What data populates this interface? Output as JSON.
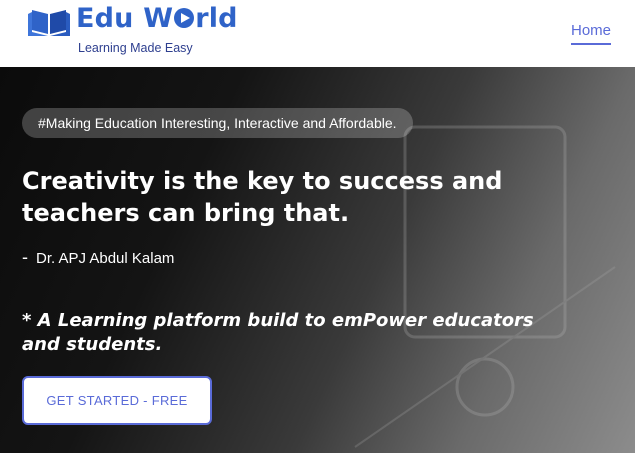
{
  "brand": {
    "name_part1": "Edu",
    "name_part2": "W",
    "name_part3": "rld",
    "tagline": "Learning Made Easy",
    "colors": {
      "primary": "#2f63c8",
      "accent": "#5a6bd8",
      "tagline": "#2e3f8f"
    }
  },
  "nav": {
    "items": [
      {
        "label": "Home",
        "active": true
      }
    ]
  },
  "hero": {
    "pill": "#Making Education Interesting, Interactive and Affordable.",
    "quote_line1": "Creativity is the key to success and",
    "quote_line2": "teachers can bring that.",
    "author_dash": "-",
    "author": "Dr. APJ Abdul Kalam",
    "platform_line1": "* A Learning platform build to emPower educators",
    "platform_line2": "and students.",
    "cta_label": "GET STARTED - FREE"
  },
  "icons": {
    "logo": "open-book-icon",
    "play": "play-icon"
  }
}
